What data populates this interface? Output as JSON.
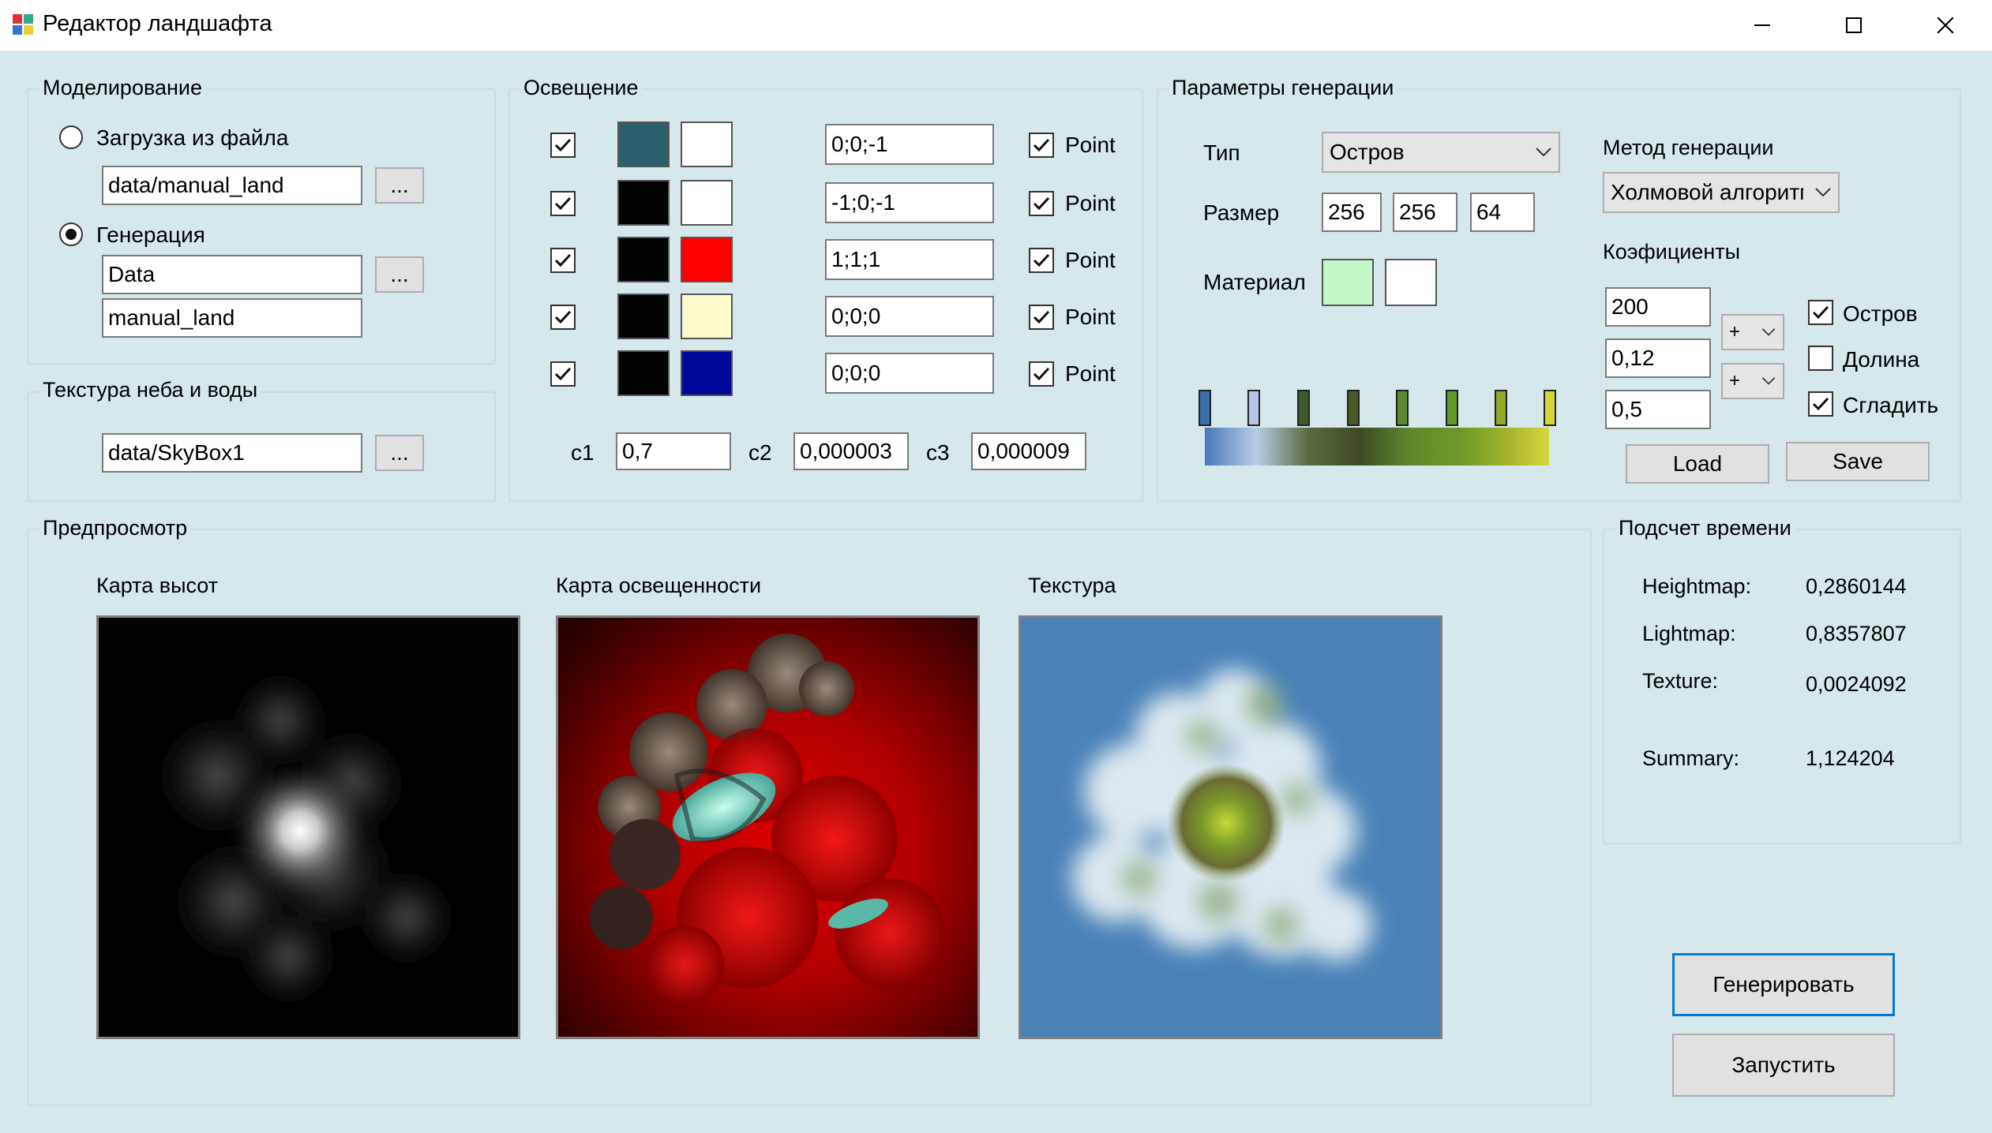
{
  "window": {
    "title": "Редактор ландшафта",
    "minimize_icon": "minimize-icon",
    "maximize_icon": "maximize-icon",
    "close_icon": "close-icon"
  },
  "modeling": {
    "group_label": "Моделирование",
    "load_from_file_label": "Загрузка из файла",
    "load_from_file_selected": false,
    "file_path": "data/manual_land",
    "browse_label": "...",
    "generation_label": "Генерация",
    "generation_selected": true,
    "gen_folder": "Data",
    "gen_name": "manual_land"
  },
  "sky_texture": {
    "group_label": "Текстура неба и воды",
    "path": "data/SkyBox1",
    "browse_label": "..."
  },
  "lighting": {
    "group_label": "Освещение",
    "lights": [
      {
        "enabled": true,
        "color1": "#2a5f6c",
        "color2": "#ffffff",
        "vector": "0;0;-1",
        "point_label": "Point",
        "point": true
      },
      {
        "enabled": true,
        "color1": "#000000",
        "color2": "#ffffff",
        "vector": "-1;0;-1",
        "point_label": "Point",
        "point": true
      },
      {
        "enabled": true,
        "color1": "#000000",
        "color2": "#ff0000",
        "vector": "1;1;1",
        "point_label": "Point",
        "point": true
      },
      {
        "enabled": true,
        "color1": "#000000",
        "color2": "#fffacc",
        "vector": "0;0;0",
        "point_label": "Point",
        "point": true
      },
      {
        "enabled": true,
        "color1": "#000000",
        "color2": "#00089a",
        "vector": "0;0;0",
        "point_label": "Point",
        "point": true
      }
    ],
    "c1_label": "c1",
    "c1": "0,7",
    "c2_label": "c2",
    "c2": "0,000003",
    "c3_label": "c3",
    "c3": "0,000009"
  },
  "generation_params": {
    "group_label": "Параметры генерации",
    "type_label": "Тип",
    "type_value": "Остров",
    "size_label": "Размер",
    "size_x": "256",
    "size_y": "256",
    "size_z": "64",
    "material_label": "Материал",
    "material_color1": "#c2f7c6",
    "material_color2": "#ffffff",
    "method_label": "Метод генерации",
    "method_value": "Холмовой алгоритм",
    "coef_label": "Коэфициенты",
    "coef1": "200",
    "coef2": "0,12",
    "coef3": "0,5",
    "op1": "+",
    "op2": "+",
    "island_label": "Остров",
    "island": true,
    "valley_label": "Долина",
    "valley": false,
    "smooth_label": "Сгладить",
    "smooth": true,
    "load_label": "Load",
    "save_label": "Save",
    "gradient_markers": [
      "#3a6fa8",
      "#b6c6e8",
      "#3c5a2a",
      "#4a5a22",
      "#5a8a2a",
      "#5e9a2a",
      "#90aa2a",
      "#d6d83a"
    ]
  },
  "preview": {
    "group_label": "Предпросмотр",
    "heightmap_label": "Карта высот",
    "lightmap_label": "Карта освещенности",
    "texture_label": "Текстура"
  },
  "timing": {
    "group_label": "Подсчет времени",
    "heightmap_label": "Heightmap:",
    "heightmap_value": "0,2860144",
    "lightmap_label": "Lightmap:",
    "lightmap_value": "0,8357807",
    "texture_label": "Texture:",
    "texture_value": "0,0024092",
    "summary_label": "Summary:",
    "summary_value": "1,124204"
  },
  "actions": {
    "generate_label": "Генерировать",
    "run_label": "Запустить"
  }
}
